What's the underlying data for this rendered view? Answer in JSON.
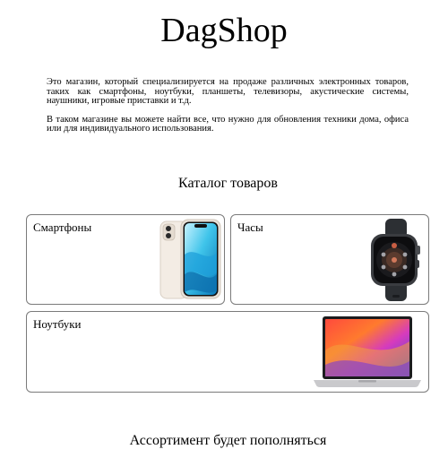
{
  "header": {
    "title": "DagShop"
  },
  "intro": {
    "paragraphs": [
      "Это магазин, который специализируется на продаже различных электронных товаров, таких как смартфоны, ноутбуки, планшеты, телевизоры, акустические системы, наушники, игровые приставки и т.д.",
      "В таком магазине вы можете найти все, что нужно для обновления техники дома, офиса или для индивидуального использования."
    ]
  },
  "catalog": {
    "heading": "Каталог товаров",
    "items": [
      {
        "label": "Смартфоны",
        "icon": "smartphone-image"
      },
      {
        "label": "Часы",
        "icon": "smartwatch-image"
      },
      {
        "label": "Ноутбуки",
        "icon": "laptop-image"
      }
    ]
  },
  "footer": {
    "text": "Ассортимент будет пополняться"
  },
  "colors": {
    "border": "#7a7a7a",
    "background": "#ffffff",
    "text": "#000000"
  }
}
